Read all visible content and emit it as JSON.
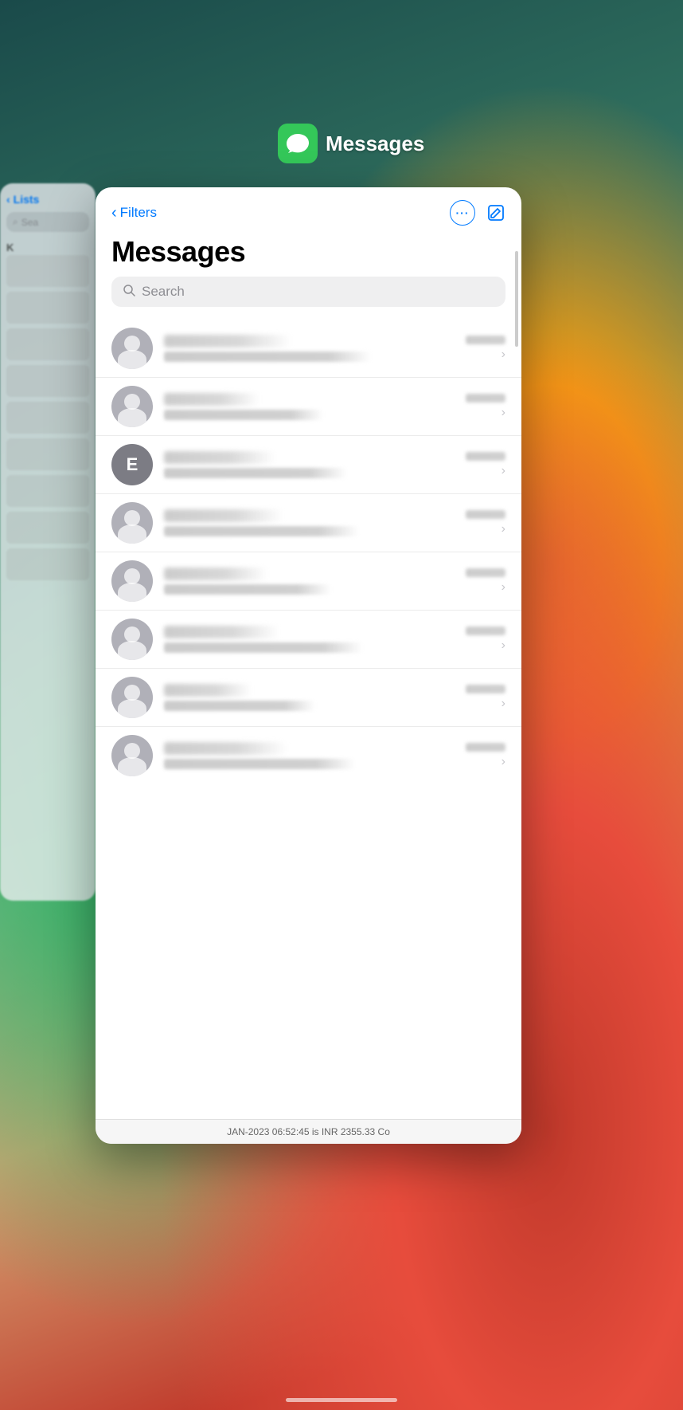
{
  "background": {
    "description": "iOS multitasking background with gradient"
  },
  "app_switcher": {
    "app_name": "Messages",
    "app_icon_color": "#34c759"
  },
  "behind_card": {
    "lists_label": "Lists",
    "search_placeholder": "Sea",
    "section_letter": "K"
  },
  "main_card": {
    "back_label": "Filters",
    "title": "Messages",
    "search_placeholder": "Search",
    "more_button_label": "···",
    "compose_button_label": "✏",
    "contacts": [
      {
        "id": 1,
        "type": "person",
        "letter": ""
      },
      {
        "id": 2,
        "type": "person",
        "letter": ""
      },
      {
        "id": 3,
        "type": "letter",
        "letter": "E"
      },
      {
        "id": 4,
        "type": "person",
        "letter": ""
      },
      {
        "id": 5,
        "type": "person",
        "letter": ""
      },
      {
        "id": 6,
        "type": "person",
        "letter": ""
      },
      {
        "id": 7,
        "type": "person",
        "letter": ""
      },
      {
        "id": 8,
        "type": "person",
        "letter": ""
      }
    ],
    "bottom_notification": "JAN-2023 06:52:45 is INR 2355.33  Co"
  }
}
